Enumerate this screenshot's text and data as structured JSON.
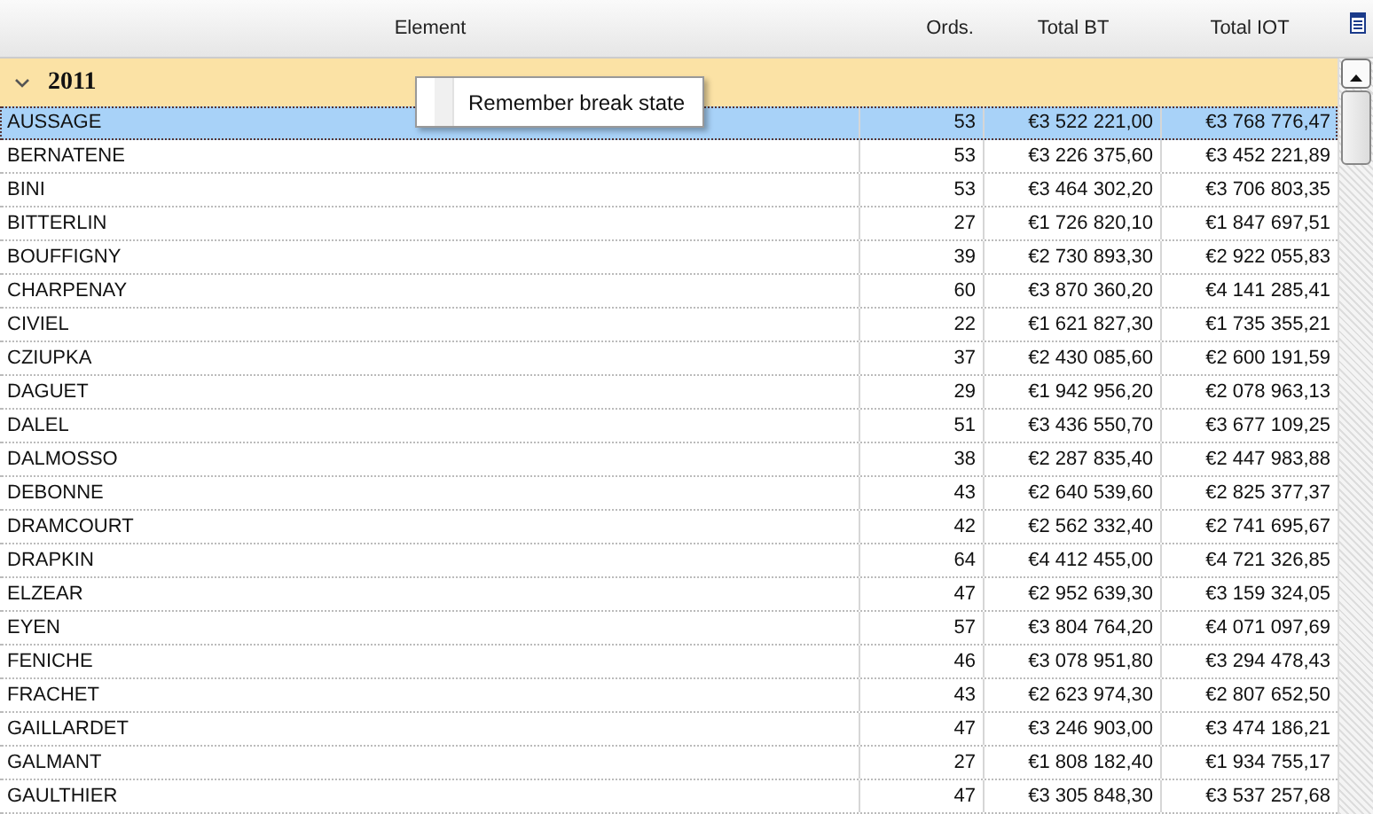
{
  "columns": [
    {
      "label": "Element"
    },
    {
      "label": "Ords."
    },
    {
      "label": "Total BT"
    },
    {
      "label": "Total IOT"
    }
  ],
  "group": {
    "label": "2011",
    "expanded": true
  },
  "context_menu": {
    "items": [
      {
        "label": "Remember break state",
        "checked": false
      }
    ]
  },
  "rows": [
    {
      "cells": [
        "AUSSAGE",
        "53",
        "€3 522 221,00",
        "€3 768 776,47"
      ],
      "selected": true
    },
    {
      "cells": [
        "BERNATENE",
        "53",
        "€3 226 375,60",
        "€3 452 221,89"
      ],
      "selected": false
    },
    {
      "cells": [
        "BINI",
        "53",
        "€3 464 302,20",
        "€3 706 803,35"
      ],
      "selected": false
    },
    {
      "cells": [
        "BITTERLIN",
        "27",
        "€1 726 820,10",
        "€1 847 697,51"
      ],
      "selected": false
    },
    {
      "cells": [
        "BOUFFIGNY",
        "39",
        "€2 730 893,30",
        "€2 922 055,83"
      ],
      "selected": false
    },
    {
      "cells": [
        "CHARPENAY",
        "60",
        "€3 870 360,20",
        "€4 141 285,41"
      ],
      "selected": false
    },
    {
      "cells": [
        "CIVIEL",
        "22",
        "€1 621 827,30",
        "€1 735 355,21"
      ],
      "selected": false
    },
    {
      "cells": [
        "CZIUPKA",
        "37",
        "€2 430 085,60",
        "€2 600 191,59"
      ],
      "selected": false
    },
    {
      "cells": [
        "DAGUET",
        "29",
        "€1 942 956,20",
        "€2 078 963,13"
      ],
      "selected": false
    },
    {
      "cells": [
        "DALEL",
        "51",
        "€3 436 550,70",
        "€3 677 109,25"
      ],
      "selected": false
    },
    {
      "cells": [
        "DALMOSSO",
        "38",
        "€2 287 835,40",
        "€2 447 983,88"
      ],
      "selected": false
    },
    {
      "cells": [
        "DEBONNE",
        "43",
        "€2 640 539,60",
        "€2 825 377,37"
      ],
      "selected": false
    },
    {
      "cells": [
        "DRAMCOURT",
        "42",
        "€2 562 332,40",
        "€2 741 695,67"
      ],
      "selected": false
    },
    {
      "cells": [
        "DRAPKIN",
        "64",
        "€4 412 455,00",
        "€4 721 326,85"
      ],
      "selected": false
    },
    {
      "cells": [
        "ELZEAR",
        "47",
        "€2 952 639,30",
        "€3 159 324,05"
      ],
      "selected": false
    },
    {
      "cells": [
        "EYEN",
        "57",
        "€3 804 764,20",
        "€4 071 097,69"
      ],
      "selected": false
    },
    {
      "cells": [
        "FENICHE",
        "46",
        "€3 078 951,80",
        "€3 294 478,43"
      ],
      "selected": false
    },
    {
      "cells": [
        "FRACHET",
        "43",
        "€2 623 974,30",
        "€2 807 652,50"
      ],
      "selected": false
    },
    {
      "cells": [
        "GAILLARDET",
        "47",
        "€3 246 903,00",
        "€3 474 186,21"
      ],
      "selected": false
    },
    {
      "cells": [
        "GALMANT",
        "27",
        "€1 808 182,40",
        "€1 934 755,17"
      ],
      "selected": false
    },
    {
      "cells": [
        "GAULTHIER",
        "47",
        "€3 305 848,30",
        "€3 537 257,68"
      ],
      "selected": false
    }
  ]
}
